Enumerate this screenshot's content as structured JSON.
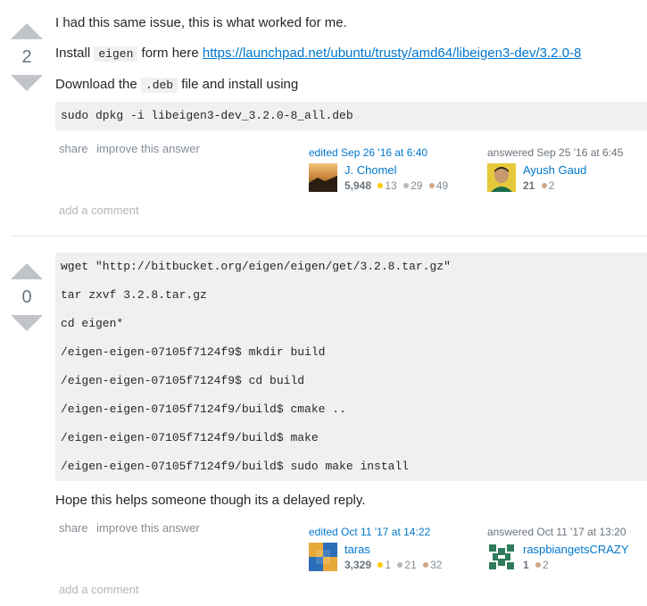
{
  "answers": [
    {
      "votes": "2",
      "text_intro": "I had this same issue, this is what worked for me.",
      "install_prefix": "Install",
      "install_code": "eigen",
      "install_mid": "form here",
      "install_link": "https://launchpad.net/ubuntu/trusty/amd64/libeigen3-dev/3.2.0-8",
      "download_prefix": "Download the",
      "download_code": ".deb",
      "download_suffix": "file and install using",
      "code_lines": [
        "sudo dpkg -i libeigen3-dev_3.2.0-8_all.deb"
      ],
      "menu": {
        "share": "share",
        "improve": "improve this answer"
      },
      "editor": {
        "action": "edited Sep 26 '16 at 6:40",
        "name": "J. Chomel",
        "rep": "5,948",
        "gold": "13",
        "silver": "29",
        "bronze": "49"
      },
      "author": {
        "action": "answered Sep 25 '16 at 6:45",
        "name": "Ayush Gaud",
        "rep": "21",
        "bronze": "2"
      },
      "add_comment": "add a comment"
    },
    {
      "votes": "0",
      "code_lines": [
        "wget \"http://bitbucket.org/eigen/eigen/get/3.2.8.tar.gz\"",
        "tar zxvf 3.2.8.tar.gz",
        "cd eigen*",
        "/eigen-eigen-07105f7124f9$ mkdir build",
        "/eigen-eigen-07105f7124f9$ cd build",
        "/eigen-eigen-07105f7124f9/build$ cmake ..",
        "/eigen-eigen-07105f7124f9/build$ make",
        "/eigen-eigen-07105f7124f9/build$ sudo make install"
      ],
      "text_outro": "Hope this helps someone though its a delayed reply.",
      "menu": {
        "share": "share",
        "improve": "improve this answer"
      },
      "editor": {
        "action": "edited Oct 11 '17 at 14:22",
        "name": "taras",
        "rep": "3,329",
        "gold": "1",
        "silver": "21",
        "bronze": "32"
      },
      "author": {
        "action": "answered Oct 11 '17 at 13:20",
        "name": "raspbiangetsCRAZY",
        "rep": "1",
        "bronze": "2"
      },
      "add_comment": "add a comment"
    }
  ],
  "colors": {
    "link": "#0077cc",
    "code_bg": "#eff0f1",
    "gold": "#ffcc01",
    "silver": "#b4b8bc",
    "bronze": "#d1a684"
  },
  "icons": [
    "upvote-arrow-icon",
    "downvote-arrow-icon",
    "badge-dot-icon"
  ]
}
